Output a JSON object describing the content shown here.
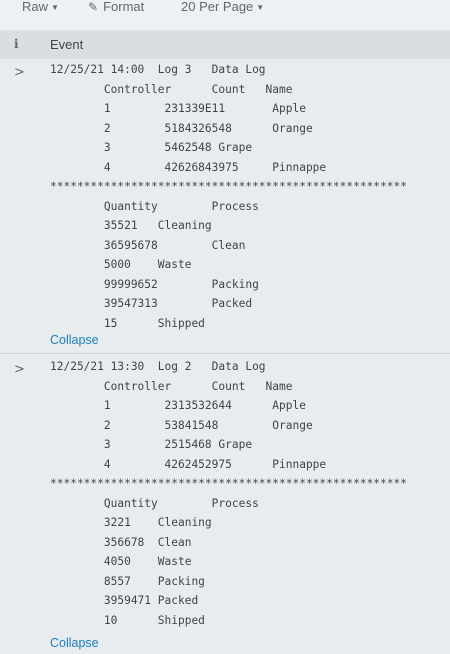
{
  "toolbar": {
    "raw_label": "Raw",
    "format_label": "Format",
    "per_page_label": "20 Per Page"
  },
  "table_header": {
    "info": "i",
    "event": "Event"
  },
  "events": [
    {
      "expand": ">",
      "text": "12/25/21 14:00  Log 3   Data Log\n        Controller      Count   Name\n        1        231339E11       Apple\n        2        5184326548      Orange\n        3        5462548 Grape\n        4        42626843975     Pinnappe\n*****************************************************\n        Quantity        Process\n        35521   Cleaning\n        36595678        Clean\n        5000    Waste\n        99999652        Packing\n        39547313        Packed\n        15      Shipped",
      "collapse": "Collapse"
    },
    {
      "expand": ">",
      "text": "12/25/21 13:30  Log 2   Data Log\n        Controller      Count   Name\n        1        2313532644      Apple\n        2        53841548        Orange\n        3        2515468 Grape\n        4        4262452975      Pinnappe\n*****************************************************\n        Quantity        Process\n        3221    Cleaning\n        356678  Clean\n        4050    Waste\n        8557    Packing\n        3959471 Packed\n        10      Shipped",
      "collapse": "Collapse"
    }
  ]
}
